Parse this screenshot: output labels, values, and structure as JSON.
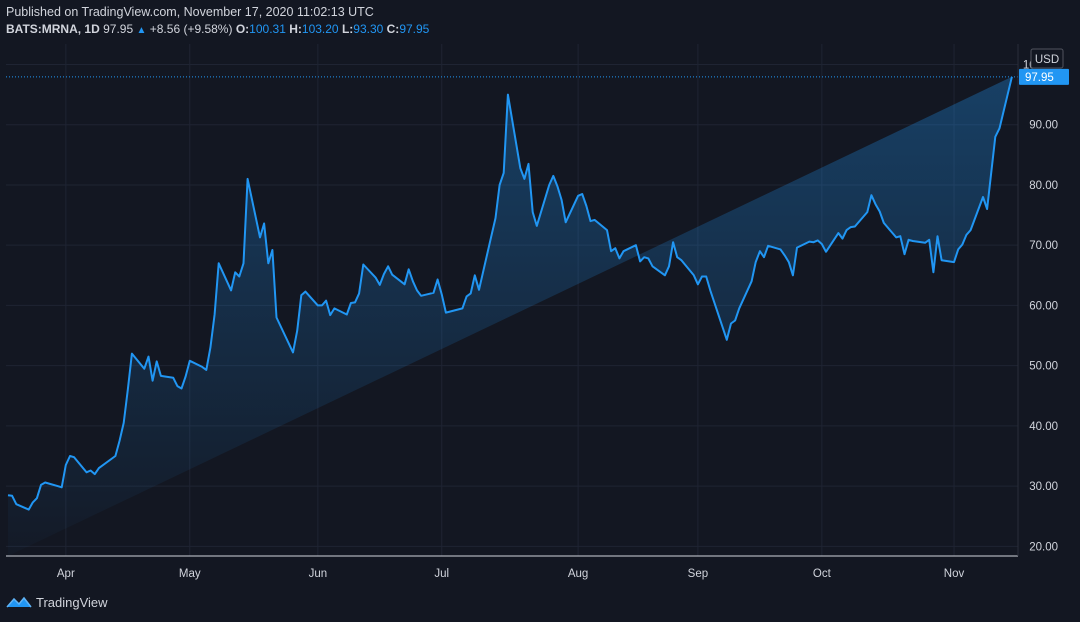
{
  "header": {
    "published": "Published on TradingView.com, November 17, 2020 11:02:13 UTC",
    "symbol": "BATS:MRNA, 1D",
    "last": "97.95",
    "change": "+8.56 (+9.58%)",
    "open_label": "O:",
    "open": "100.31",
    "high_label": "H:",
    "high": "103.20",
    "low_label": "L:",
    "low": "93.30",
    "close_label": "C:",
    "close": "97.95"
  },
  "currency": "USD",
  "footer": {
    "brand": "TradingView"
  },
  "colors": {
    "background": "#131722",
    "line": "#2196f3",
    "grid": "#1f2433",
    "price_tag": "#2196f3"
  },
  "chart_data": {
    "type": "area",
    "ylim": [
      18.4,
      103.4
    ],
    "yticks": [
      "20.00",
      "30.00",
      "40.00",
      "50.00",
      "60.00",
      "70.00",
      "80.00",
      "90.00",
      "100.00"
    ],
    "xticks": [
      {
        "label": "Apr",
        "date": "2020-04-01"
      },
      {
        "label": "May",
        "date": "2020-05-01"
      },
      {
        "label": "Jun",
        "date": "2020-06-01"
      },
      {
        "label": "Jul",
        "date": "2020-07-01"
      },
      {
        "label": "Aug",
        "date": "2020-08-03"
      },
      {
        "label": "Sep",
        "date": "2020-09-01"
      },
      {
        "label": "Oct",
        "date": "2020-10-01"
      },
      {
        "label": "Nov",
        "date": "2020-11-02"
      }
    ],
    "last_price_label": "97.95",
    "last_price": 97.95,
    "x": [
      "2020-03-18",
      "2020-03-19",
      "2020-03-20",
      "2020-03-23",
      "2020-03-24",
      "2020-03-25",
      "2020-03-26",
      "2020-03-27",
      "2020-03-30",
      "2020-03-31",
      "2020-04-01",
      "2020-04-02",
      "2020-04-03",
      "2020-04-06",
      "2020-04-07",
      "2020-04-08",
      "2020-04-09",
      "2020-04-13",
      "2020-04-14",
      "2020-04-15",
      "2020-04-16",
      "2020-04-17",
      "2020-04-20",
      "2020-04-21",
      "2020-04-22",
      "2020-04-23",
      "2020-04-24",
      "2020-04-27",
      "2020-04-28",
      "2020-04-29",
      "2020-04-30",
      "2020-05-01",
      "2020-05-04",
      "2020-05-05",
      "2020-05-06",
      "2020-05-07",
      "2020-05-08",
      "2020-05-11",
      "2020-05-12",
      "2020-05-13",
      "2020-05-14",
      "2020-05-15",
      "2020-05-18",
      "2020-05-19",
      "2020-05-20",
      "2020-05-21",
      "2020-05-22",
      "2020-05-26",
      "2020-05-27",
      "2020-05-28",
      "2020-05-29",
      "2020-06-01",
      "2020-06-02",
      "2020-06-03",
      "2020-06-04",
      "2020-06-05",
      "2020-06-08",
      "2020-06-09",
      "2020-06-10",
      "2020-06-11",
      "2020-06-12",
      "2020-06-15",
      "2020-06-16",
      "2020-06-17",
      "2020-06-18",
      "2020-06-19",
      "2020-06-22",
      "2020-06-23",
      "2020-06-24",
      "2020-06-25",
      "2020-06-26",
      "2020-06-29",
      "2020-06-30",
      "2020-07-01",
      "2020-07-02",
      "2020-07-06",
      "2020-07-07",
      "2020-07-08",
      "2020-07-09",
      "2020-07-10",
      "2020-07-13",
      "2020-07-14",
      "2020-07-15",
      "2020-07-16",
      "2020-07-17",
      "2020-07-20",
      "2020-07-21",
      "2020-07-22",
      "2020-07-23",
      "2020-07-24",
      "2020-07-27",
      "2020-07-28",
      "2020-07-29",
      "2020-07-30",
      "2020-07-31",
      "2020-08-03",
      "2020-08-04",
      "2020-08-05",
      "2020-08-06",
      "2020-08-07",
      "2020-08-10",
      "2020-08-11",
      "2020-08-12",
      "2020-08-13",
      "2020-08-14",
      "2020-08-17",
      "2020-08-18",
      "2020-08-19",
      "2020-08-20",
      "2020-08-21",
      "2020-08-24",
      "2020-08-25",
      "2020-08-26",
      "2020-08-27",
      "2020-08-28",
      "2020-08-31",
      "2020-09-01",
      "2020-09-02",
      "2020-09-03",
      "2020-09-04",
      "2020-09-08",
      "2020-09-09",
      "2020-09-10",
      "2020-09-11",
      "2020-09-14",
      "2020-09-15",
      "2020-09-16",
      "2020-09-17",
      "2020-09-18",
      "2020-09-21",
      "2020-09-22",
      "2020-09-23",
      "2020-09-24",
      "2020-09-25",
      "2020-09-28",
      "2020-09-29",
      "2020-09-30",
      "2020-10-01",
      "2020-10-02",
      "2020-10-05",
      "2020-10-06",
      "2020-10-07",
      "2020-10-08",
      "2020-10-09",
      "2020-10-12",
      "2020-10-13",
      "2020-10-14",
      "2020-10-15",
      "2020-10-16",
      "2020-10-19",
      "2020-10-20",
      "2020-10-21",
      "2020-10-22",
      "2020-10-23",
      "2020-10-26",
      "2020-10-27",
      "2020-10-28",
      "2020-10-29",
      "2020-10-30",
      "2020-11-02",
      "2020-11-03",
      "2020-11-04",
      "2020-11-05",
      "2020-11-06",
      "2020-11-09",
      "2020-11-10",
      "2020-11-11",
      "2020-11-12",
      "2020-11-13",
      "2020-11-16",
      "2020-11-17"
    ],
    "y": [
      28.5,
      28.4,
      27.0,
      26.1,
      27.3,
      28.0,
      30.2,
      30.6,
      30.0,
      29.8,
      33.5,
      35.0,
      34.8,
      32.3,
      32.6,
      32.0,
      33.0,
      35.0,
      37.5,
      40.5,
      46.0,
      52.0,
      49.5,
      51.5,
      47.5,
      50.7,
      48.3,
      48.0,
      46.6,
      46.2,
      48.2,
      50.8,
      49.8,
      49.3,
      53.0,
      58.5,
      67.0,
      62.5,
      65.5,
      64.8,
      67.0,
      81.0,
      71.3,
      73.6,
      67.0,
      69.2,
      58.0,
      52.2,
      55.8,
      61.7,
      62.3,
      60.0,
      60.0,
      60.8,
      58.4,
      59.5,
      58.5,
      60.4,
      60.5,
      62.0,
      66.8,
      64.6,
      63.4,
      65.2,
      66.5,
      65.1,
      63.5,
      66.0,
      64.0,
      62.5,
      61.6,
      62.1,
      64.3,
      61.8,
      58.8,
      59.5,
      61.5,
      62.0,
      65.0,
      62.6,
      71.5,
      74.5,
      80.0,
      82.0,
      95.0,
      82.8,
      81.0,
      83.5,
      75.5,
      73.2,
      80.0,
      81.5,
      79.8,
      77.5,
      73.8,
      78.2,
      78.5,
      76.5,
      74.0,
      74.2,
      72.5,
      69.0,
      69.5,
      67.8,
      69.0,
      70.0,
      67.3,
      68.0,
      67.8,
      66.5,
      65.0,
      66.5,
      70.5,
      68.0,
      67.5,
      65.0,
      63.5,
      64.8,
      64.8,
      62.5,
      54.3,
      57.0,
      57.5,
      59.5,
      64.0,
      67.2,
      69.0,
      68.0,
      69.9,
      69.3,
      68.3,
      67.2,
      65.0,
      69.6,
      70.6,
      70.5,
      70.8,
      70.2,
      68.9,
      72.0,
      71.1,
      72.5,
      73.0,
      73.1,
      75.5,
      78.3,
      76.8,
      75.6,
      73.7,
      71.3,
      71.5,
      68.5,
      70.9,
      70.7,
      70.4,
      70.9,
      65.5,
      71.5,
      67.5,
      67.2,
      69.3,
      70.1,
      71.7,
      72.5,
      78.0,
      76.0,
      82.0,
      88.0,
      89.4,
      97.95
    ]
  }
}
